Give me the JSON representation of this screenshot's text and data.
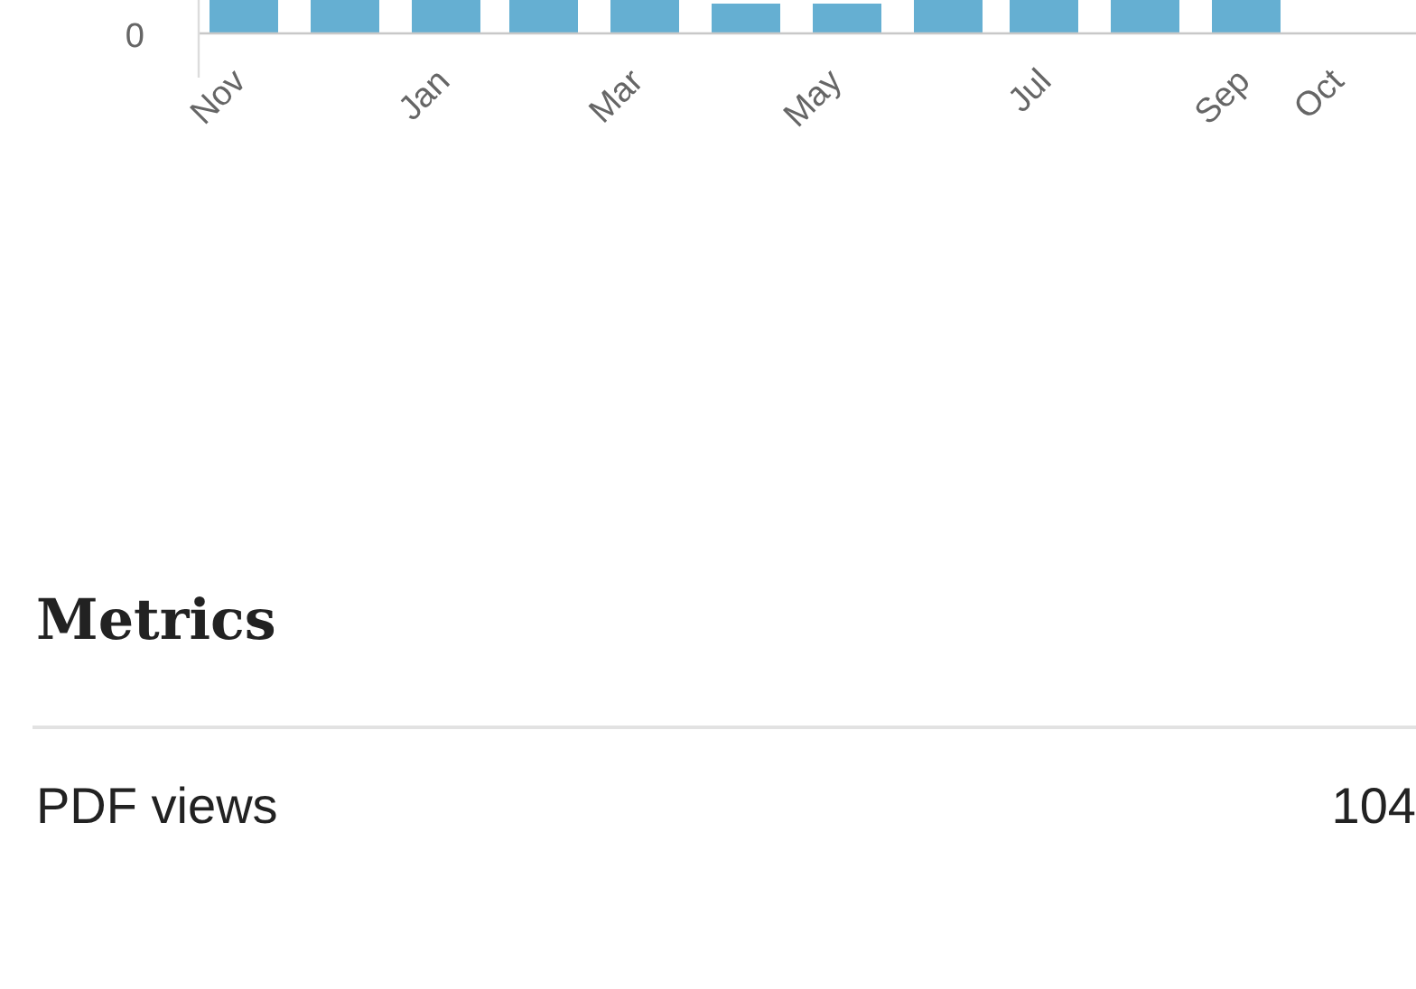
{
  "chart": {
    "y_tick": "0",
    "x_labels": [
      "Nov",
      "Jan",
      "Mar",
      "May",
      "Jul",
      "Sep",
      "Oct"
    ]
  },
  "metrics": {
    "title": "Metrics",
    "rows": [
      {
        "label": "PDF views",
        "value": "104"
      }
    ]
  }
}
